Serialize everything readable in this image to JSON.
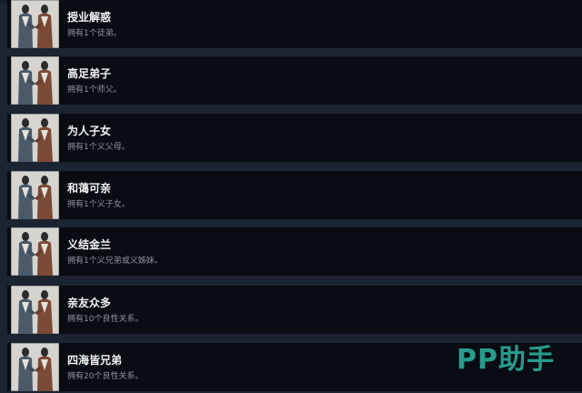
{
  "achievements": [
    {
      "title": "授业解惑",
      "desc": "拥有1个徒弟。",
      "icon": "two-figures-icon"
    },
    {
      "title": "高足弟子",
      "desc": "拥有1个师父。",
      "icon": "two-figures-icon"
    },
    {
      "title": "为人子女",
      "desc": "拥有1个义父母。",
      "icon": "two-figures-icon"
    },
    {
      "title": "和蔼可亲",
      "desc": "拥有1个义子女。",
      "icon": "two-figures-icon"
    },
    {
      "title": "义结金兰",
      "desc": "拥有1个义兄弟或义姊妹。",
      "icon": "two-figures-icon"
    },
    {
      "title": "亲友众多",
      "desc": "拥有10个良性关系。",
      "icon": "two-figures-icon"
    },
    {
      "title": "四海皆兄弟",
      "desc": "拥有20个良性关系。",
      "icon": "two-figures-icon"
    }
  ],
  "watermark": "PP助手",
  "colors": {
    "row_bg": "#090c12",
    "separator": "#1b2430",
    "title": "#f1f1f1",
    "desc": "#8a929b",
    "watermark": "#2aa395"
  }
}
